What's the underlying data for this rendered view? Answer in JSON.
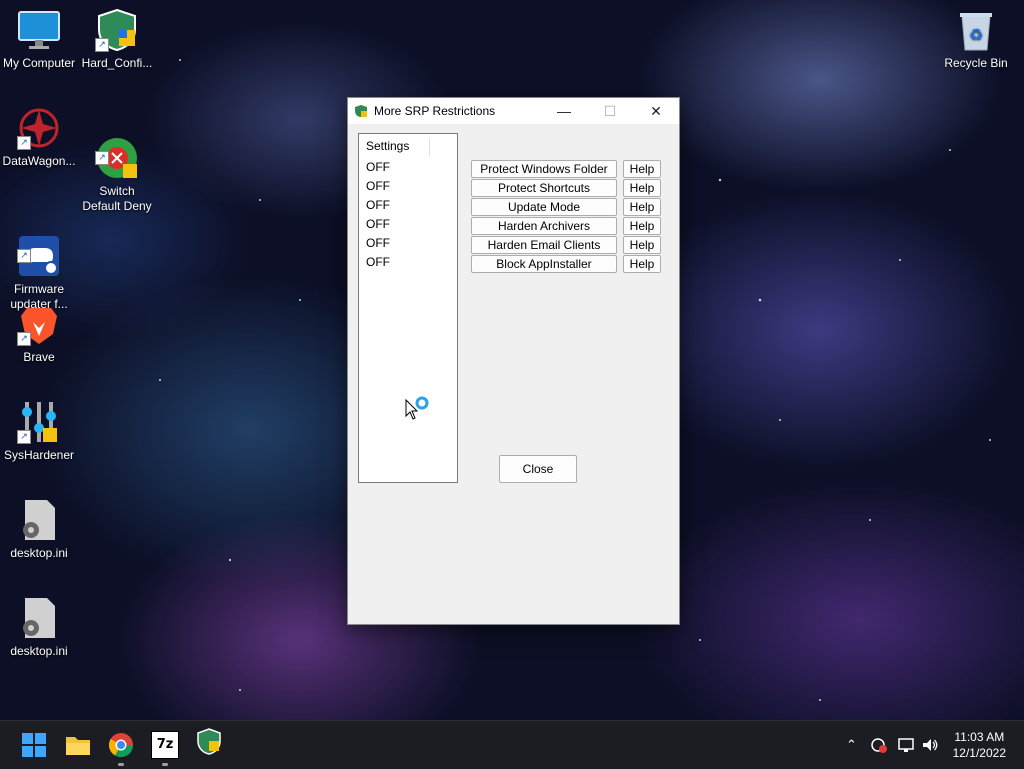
{
  "desktop": {
    "icons": [
      {
        "label": "My Computer"
      },
      {
        "label": "Hard_Confi..."
      },
      {
        "label": "DataWagon..."
      },
      {
        "label": "Switch\nDefault Deny"
      },
      {
        "label": "Firmware\nupdater f..."
      },
      {
        "label": "Brave"
      },
      {
        "label": "SysHardener"
      },
      {
        "label": "desktop.ini"
      },
      {
        "label": "desktop.ini"
      },
      {
        "label": "Recycle Bin"
      }
    ]
  },
  "window": {
    "title": "More SRP Restrictions",
    "list_header": "Settings",
    "statuses": [
      "OFF",
      "OFF",
      "OFF",
      "OFF",
      "OFF",
      "OFF"
    ],
    "actions": [
      {
        "label": "Protect Windows Folder",
        "help": "Help"
      },
      {
        "label": "Protect Shortcuts",
        "help": "Help"
      },
      {
        "label": "Update Mode",
        "help": "Help"
      },
      {
        "label": "Harden Archivers",
        "help": "Help"
      },
      {
        "label": "Harden Email Clients",
        "help": "Help"
      },
      {
        "label": "Block AppInstaller",
        "help": "Help"
      }
    ],
    "close_label": "Close"
  },
  "taskbar": {
    "seven_zip": "7z",
    "time": "11:03 AM",
    "date": "12/1/2022"
  },
  "colors": {
    "accent": "#0078d4",
    "taskbar": "#1c1d22"
  }
}
